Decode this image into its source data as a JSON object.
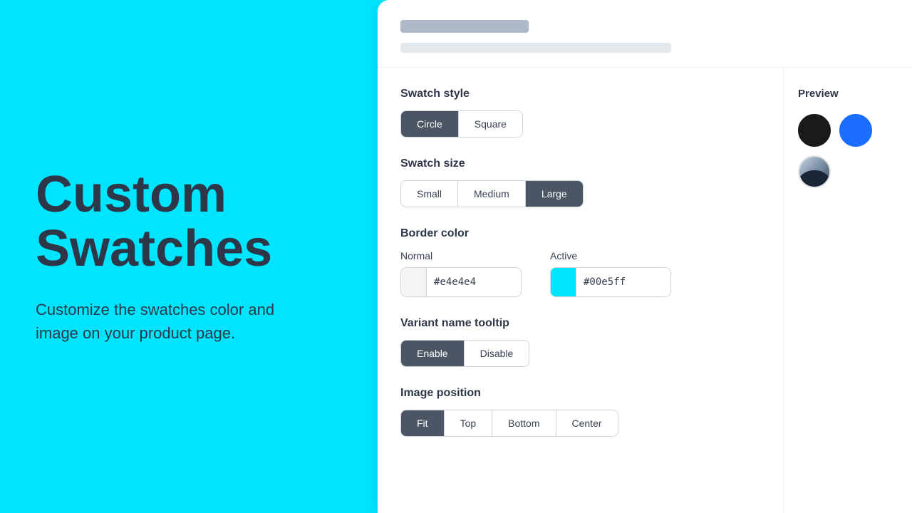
{
  "left": {
    "headline_line1": "Custom",
    "headline_line2": "Swatches",
    "description": "Customize the swatches color and image on your product page."
  },
  "header": {
    "skeleton_title_visible": true,
    "skeleton_subtitle_visible": true
  },
  "preview": {
    "title": "Preview",
    "swatches": [
      {
        "id": "black",
        "label": "Black swatch"
      },
      {
        "id": "blue",
        "label": "Blue swatch"
      },
      {
        "id": "image",
        "label": "Image swatch"
      }
    ]
  },
  "swatch_style": {
    "title": "Swatch style",
    "options": [
      "Circle",
      "Square"
    ],
    "active": "Circle"
  },
  "swatch_size": {
    "title": "Swatch size",
    "options": [
      "Small",
      "Medium",
      "Large"
    ],
    "active": "Large"
  },
  "border_color": {
    "title": "Border color",
    "normal": {
      "label": "Normal",
      "value": "#e4e4e4",
      "display": "#e4e4e4"
    },
    "active": {
      "label": "Active",
      "value": "#00e5ff",
      "display": "#00e5ff"
    }
  },
  "variant_tooltip": {
    "title": "Variant name tooltip",
    "options": [
      "Enable",
      "Disable"
    ],
    "active": "Enable"
  },
  "image_position": {
    "title": "Image position",
    "options": [
      "Fit",
      "Top",
      "Bottom",
      "Center"
    ],
    "active": "Fit"
  }
}
